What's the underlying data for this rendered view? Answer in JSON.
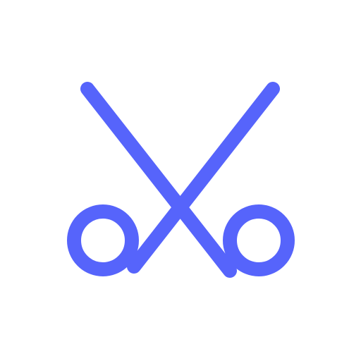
{
  "icon": {
    "name": "scissors-icon",
    "color": "#5664fb",
    "background": "#ffffff"
  }
}
